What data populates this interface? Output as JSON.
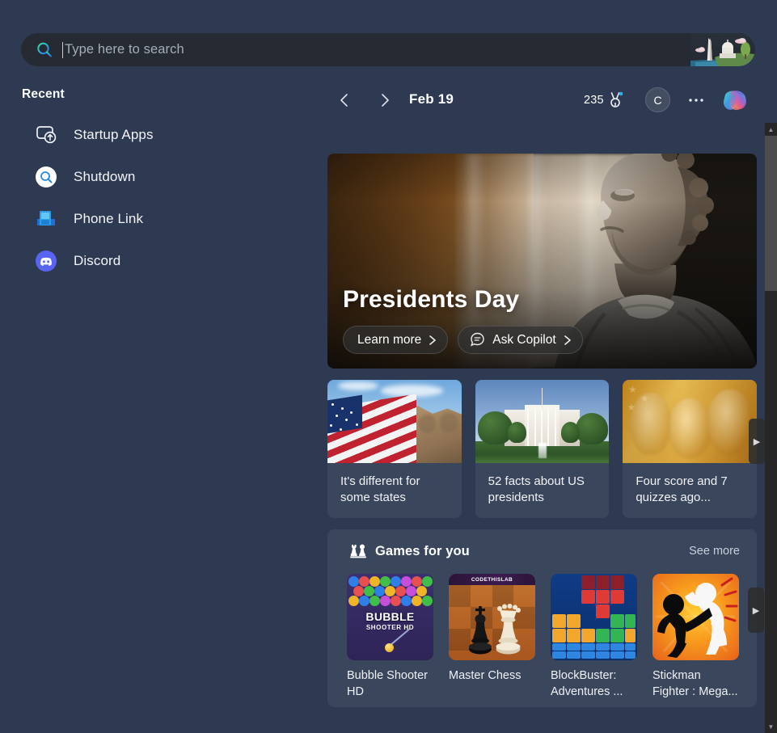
{
  "search": {
    "placeholder": "Type here to search",
    "icon": "search-icon",
    "badge_icon": "washington-dc-skyline-illustration"
  },
  "header": {
    "prev_icon": "chevron-left-icon",
    "next_icon": "chevron-right-icon",
    "date": "Feb 19",
    "rewards_count": "235",
    "rewards_icon": "rewards-medal-icon",
    "avatar_initial": "C",
    "more_label": "•••",
    "copilot_icon": "copilot-icon"
  },
  "sidebar": {
    "title": "Recent",
    "items": [
      {
        "label": "Startup Apps",
        "icon": "startup-apps-icon"
      },
      {
        "label": "Shutdown",
        "icon": "search-result-icon"
      },
      {
        "label": "Phone Link",
        "icon": "phone-link-icon"
      },
      {
        "label": "Discord",
        "icon": "discord-icon"
      }
    ]
  },
  "hero": {
    "title": "Presidents Day",
    "image_alt": "george-washington-statue",
    "buttons": [
      {
        "label": "Learn more",
        "icon": "chevron-right-icon"
      },
      {
        "label": "Ask Copilot",
        "icon": "copilot-chat-icon"
      }
    ]
  },
  "cards": {
    "next_arrow_icon": "carousel-next-icon",
    "items": [
      {
        "title": "It's different for some states",
        "image_alt": "mount-rushmore-with-us-flag"
      },
      {
        "title": "52 facts about US presidents",
        "image_alt": "white-house-exterior"
      },
      {
        "title": "Four score and 7 quizzes ago...",
        "image_alt": "sepia-presidents-collage"
      }
    ]
  },
  "games": {
    "title": "Games for you",
    "icon": "chess-pieces-icon",
    "see_more": "See more",
    "next_arrow_icon": "carousel-next-icon",
    "items": [
      {
        "name": "Bubble Shooter HD",
        "tile_text": "BUBBLE",
        "tile_text2": "SHOOTER HD"
      },
      {
        "name": "Master Chess",
        "brand": "CODETHISLAB"
      },
      {
        "name": "BlockBuster: Adventures ..."
      },
      {
        "name": "Stickman Fighter : Mega..."
      }
    ]
  },
  "scrollbar": {
    "up_icon": "scroll-up-icon",
    "down_icon": "scroll-down-icon"
  },
  "colors": {
    "background": "#2e3a52",
    "card": "#3a465c",
    "searchbar": "#252a33",
    "text": "#ffffff"
  }
}
